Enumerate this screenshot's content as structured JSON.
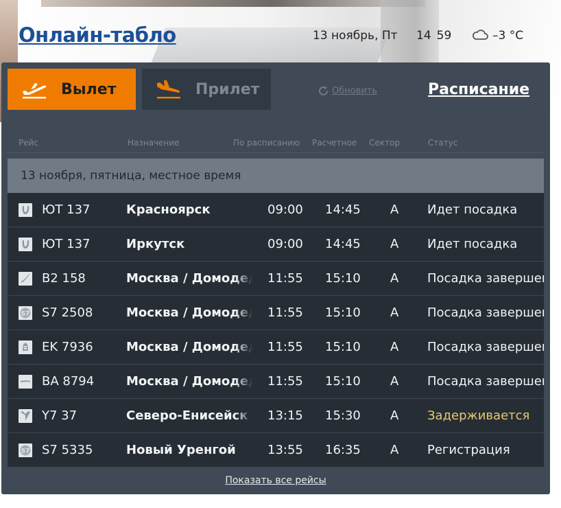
{
  "header": {
    "title": "Онлайн-табло",
    "date": "13 ноябрь, Пт",
    "time_hours": "14",
    "time_minutes": "59",
    "weather_icon": "cloud-icon",
    "temperature": "–3 °C"
  },
  "tabs": {
    "departure": {
      "label": "Вылет",
      "icon": "plane-takeoff-icon",
      "active": true,
      "color": "#ef7c00"
    },
    "arrival": {
      "label": "Прилет",
      "icon": "plane-landing-icon",
      "active": false
    }
  },
  "toolbar": {
    "refresh_label": "Обновить",
    "schedule_label": "Расписание"
  },
  "table": {
    "columns": [
      "Рейс",
      "Назначение",
      "По расписанию",
      "Расчетное",
      "Сектор",
      "Статус"
    ],
    "date_header": "13 ноября, пятница, местное время",
    "rows": [
      {
        "airline_icon": "utair-logo-icon",
        "flight": "ЮТ 137",
        "destination": "Красноярск",
        "scheduled": "09:00",
        "estimated": "14:45",
        "sector": "A",
        "status": "Идет посадка",
        "status_color": "#f2f4f6"
      },
      {
        "airline_icon": "utair-logo-icon",
        "flight": "ЮТ 137",
        "destination": "Иркутск",
        "scheduled": "09:00",
        "estimated": "14:45",
        "sector": "A",
        "status": "Идет посадка",
        "status_color": "#f2f4f6"
      },
      {
        "airline_icon": "b2-logo-icon",
        "flight": "B2 158",
        "destination": "Москва / Домодедово",
        "scheduled": "11:55",
        "estimated": "15:10",
        "sector": "A",
        "status": "Посадка завершена",
        "status_color": "#f2f4f6"
      },
      {
        "airline_icon": "s7-logo-icon",
        "flight": "S7 2508",
        "destination": "Москва / Домодедово",
        "scheduled": "11:55",
        "estimated": "15:10",
        "sector": "A",
        "status": "Посадка завершена",
        "status_color": "#f2f4f6"
      },
      {
        "airline_icon": "emirates-logo-icon",
        "flight": "EK 7936",
        "destination": "Москва / Домодедово",
        "scheduled": "11:55",
        "estimated": "15:10",
        "sector": "A",
        "status": "Посадка завершена",
        "status_color": "#f2f4f6"
      },
      {
        "airline_icon": "ba-logo-icon",
        "flight": "BA 8794",
        "destination": "Москва / Домодедово",
        "scheduled": "11:55",
        "estimated": "15:10",
        "sector": "A",
        "status": "Посадка завершена",
        "status_color": "#f2f4f6"
      },
      {
        "airline_icon": "y7-logo-icon",
        "flight": "Y7 37",
        "destination": "Северо-Енисейск",
        "scheduled": "13:15",
        "estimated": "15:30",
        "sector": "A",
        "status": "Задерживается",
        "status_color": "#e8c870"
      },
      {
        "airline_icon": "s7-logo-icon",
        "flight": "S7 5335",
        "destination": "Новый Уренгой",
        "scheduled": "13:55",
        "estimated": "16:35",
        "sector": "A",
        "status": "Регистрация",
        "status_color": "#f2f4f6"
      }
    ]
  },
  "footer": {
    "show_all_label": "Показать все рейсы"
  }
}
